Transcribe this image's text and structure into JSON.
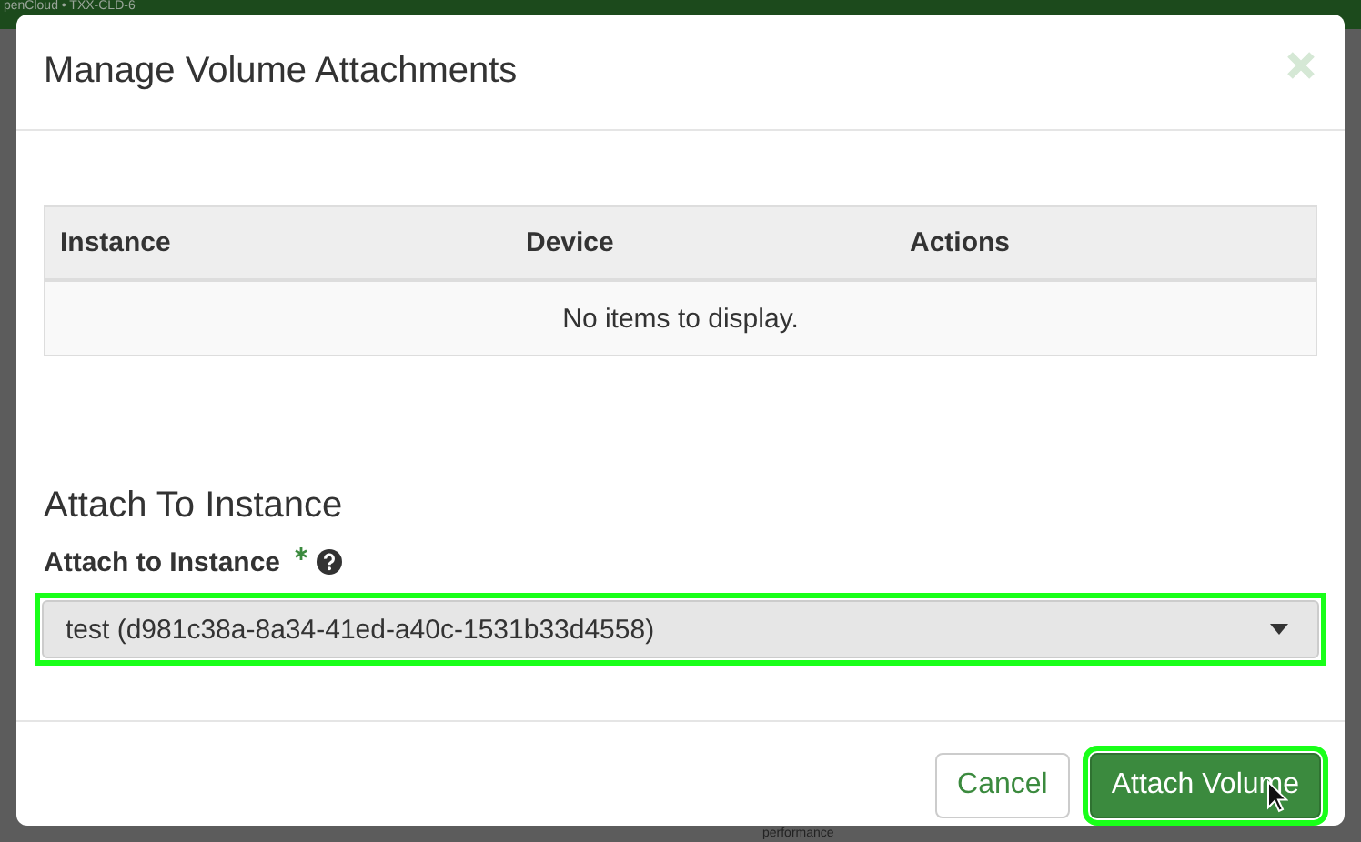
{
  "background": {
    "header_text": "penCloud • TXX-CLD-6",
    "fragment": "performance"
  },
  "modal": {
    "title": "Manage Volume Attachments",
    "table": {
      "columns": [
        "Instance",
        "Device",
        "Actions"
      ],
      "empty_text": "No items to display."
    },
    "section_title": "Attach To Instance",
    "field": {
      "label": "Attach to Instance",
      "required": true,
      "value": "test (d981c38a-8a34-41ed-a40c-1531b33d4558)",
      "highlighted": true
    },
    "buttons": [
      {
        "label": "Cancel",
        "kind": "secondary",
        "highlighted": false
      },
      {
        "label": "Attach Volume",
        "kind": "primary",
        "highlighted": true
      }
    ]
  }
}
